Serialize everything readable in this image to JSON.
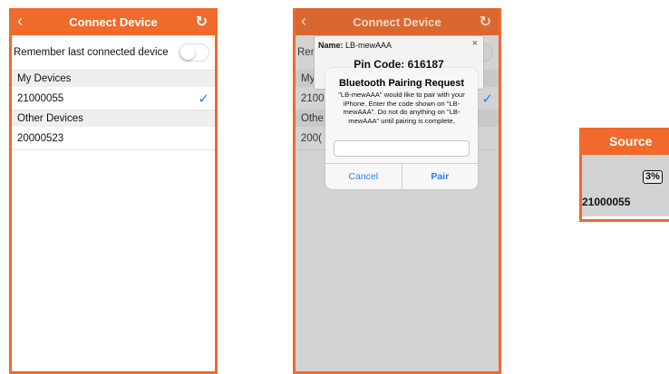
{
  "phone1": {
    "nav": {
      "title": "Connect Device",
      "back": "‹",
      "refresh": "↻"
    },
    "remember_label": "Remember last connected device",
    "toggle_on": false,
    "sections": {
      "my_devices": "My Devices",
      "other_devices": "Other Devices"
    },
    "my_devices": [
      {
        "id": "21000055",
        "connected": true,
        "check": "✓"
      }
    ],
    "other_devices": [
      {
        "id": "20000523"
      }
    ]
  },
  "phone2": {
    "nav": {
      "title": "Connect Device",
      "back": "‹",
      "refresh": "↻"
    },
    "bg_rows": {
      "remember": "Ren",
      "my": "My",
      "dev": "2100",
      "other": "Othe",
      "dev2": "200(",
      "check": "✓"
    },
    "name_popup": {
      "name_label": "Name:",
      "name_value": "LB-mewAAA",
      "close": "×",
      "pin_label": "Pin Code:",
      "pin_value": "616187"
    },
    "alert": {
      "title": "Bluetooth Pairing Request",
      "message": "\"LB-mewAAA\" would like to pair with your iPhone. Enter the code shown on \"LB-mewAAA\". Do not do anything on \"LB-mewAAA\" until pairing is complete.",
      "input_value": "",
      "cancel": "Cancel",
      "pair": "Pair"
    }
  },
  "source": {
    "header": "Source",
    "percent": "3%",
    "device_id": "21000055"
  },
  "colors": {
    "accent": "#ef6a2b",
    "link_blue": "#2d7cf6",
    "section_bg": "#efeff2"
  }
}
